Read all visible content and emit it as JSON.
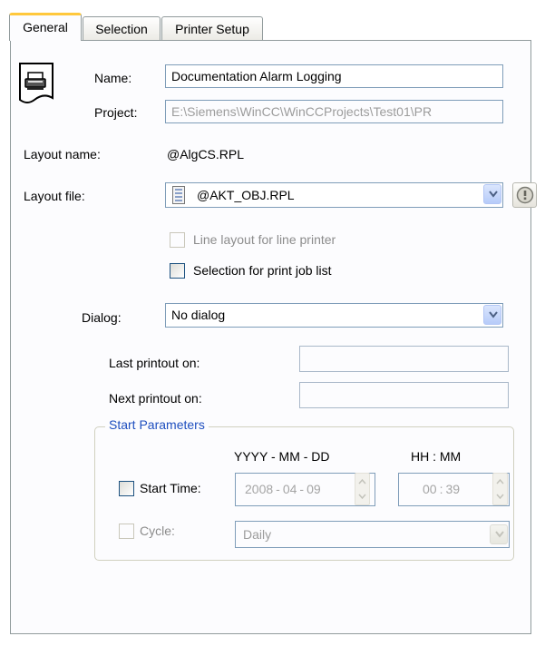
{
  "tabs": [
    {
      "label": "General",
      "active": true
    },
    {
      "label": "Selection",
      "active": false
    },
    {
      "label": "Printer Setup",
      "active": false
    }
  ],
  "general": {
    "name_label": "Name:",
    "name_value": "Documentation Alarm Logging",
    "project_label": "Project:",
    "project_value": "E:\\Siemens\\WinCC\\WinCCProjects\\Test01\\PR",
    "layout_name_label": "Layout name:",
    "layout_name_value": "@AlgCS.RPL",
    "layout_file_label": "Layout file:",
    "layout_file_value": "@AKT_OBJ.RPL",
    "line_layout_label": "Line layout for line printer",
    "selection_print_label": "Selection for print job list",
    "dialog_label": "Dialog:",
    "dialog_value": "No dialog",
    "last_printout_label": "Last printout on:",
    "next_printout_label": "Next printout on:"
  },
  "start_parameters": {
    "title": "Start Parameters",
    "date_format": "YYYY - MM - DD",
    "time_format": "HH : MM",
    "start_time_label": "Start Time:",
    "year": "2008",
    "month": "04",
    "day": "09",
    "hour": "00",
    "minute": "39",
    "cycle_label": "Cycle:",
    "cycle_value": "Daily"
  },
  "icons": {
    "printer": "printer-icon",
    "info": "info-icon",
    "layout_doc": "document-icon",
    "dropdown": "chevron-down-icon"
  },
  "colors": {
    "accent_tab": "#ffc83c",
    "group_title": "#1f4fbf",
    "field_border": "#7f9db9"
  }
}
